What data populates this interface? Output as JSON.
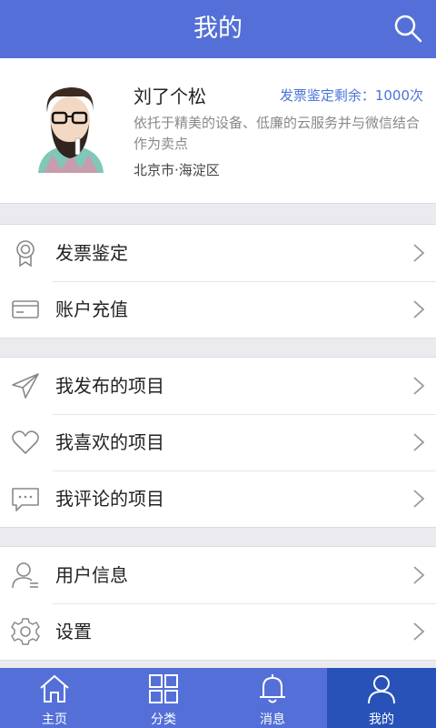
{
  "header": {
    "title": "我的",
    "search_icon": "search-icon"
  },
  "profile": {
    "name": "刘了个松",
    "quota": "发票鉴定剩余：1000次",
    "bio": "依托于精美的设备、低廉的云服务并与微信结合作为卖点",
    "location": "北京市·海淀区"
  },
  "menu": {
    "group1": [
      {
        "label": "发票鉴定",
        "icon": "award-icon"
      },
      {
        "label": "账户充值",
        "icon": "card-icon"
      }
    ],
    "group2": [
      {
        "label": "我发布的项目",
        "icon": "send-icon"
      },
      {
        "label": "我喜欢的项目",
        "icon": "heart-icon"
      },
      {
        "label": "我评论的项目",
        "icon": "comment-icon"
      }
    ],
    "group3": [
      {
        "label": "用户信息",
        "icon": "user-icon"
      },
      {
        "label": "设置",
        "icon": "gear-icon"
      }
    ]
  },
  "tabs": [
    {
      "label": "主页",
      "icon": "home-icon"
    },
    {
      "label": "分类",
      "icon": "grid-icon"
    },
    {
      "label": "消息",
      "icon": "bell-icon"
    },
    {
      "label": "我的",
      "icon": "person-icon",
      "active": true
    }
  ],
  "colors": {
    "primary": "#5470d8",
    "active_tab": "#2852b8",
    "accent_text": "#4a74d8"
  }
}
